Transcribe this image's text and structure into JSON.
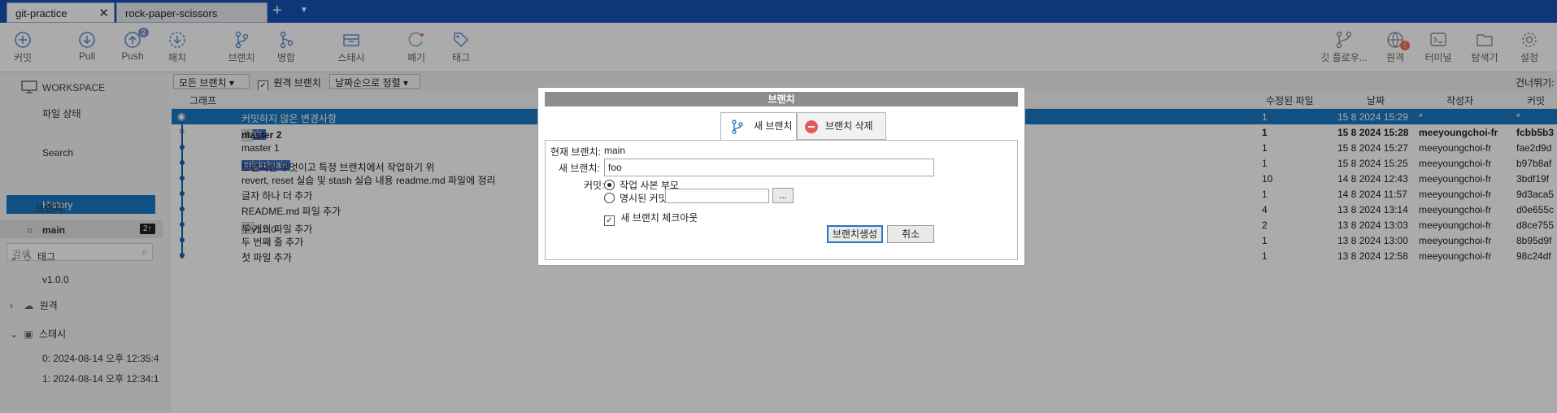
{
  "tabs": [
    {
      "label": "git-practice",
      "active": true
    },
    {
      "label": "rock-paper-scissors",
      "active": false
    }
  ],
  "toolbar": {
    "commit": "커밋",
    "pull": "Pull",
    "push": "Push",
    "push_badge": "2",
    "fetch": "패치",
    "branch": "브랜치",
    "merge": "병합",
    "stash": "스태시",
    "discard": "폐기",
    "tag": "태그",
    "git_flow": "깃 플로우...",
    "remote": "원격",
    "remote_badge": "!",
    "terminal": "터미널",
    "explorer": "탐색기",
    "settings": "설정"
  },
  "sidebar": {
    "workspace": "WORKSPACE",
    "file_status": "파일 상태",
    "history": "History",
    "search": "Search",
    "search_placeholder": "검색",
    "branches_header": "브랜치",
    "branch_main": "main",
    "branch_main_badge": "2↑",
    "tags_header": "태그",
    "tag_v1": "v1.0.0",
    "remotes_header": "원격",
    "stashes_header": "스태시",
    "stash_0": "0: 2024-08-14 오후 12:35:4",
    "stash_1": "1: 2024-08-14 오후 12:34:1"
  },
  "filter": {
    "all_branches": "모든 브랜치 ▾",
    "remote_branches": "원격 브랜치",
    "sort": "날짜순으로 정렬 ▾",
    "skip": "건너뛰기:"
  },
  "columns": {
    "graph": "그래프",
    "modified": "수정된 파일",
    "date": "날짜",
    "author": "작성자",
    "commit": "커밋"
  },
  "commits": [
    {
      "desc": "커밋하지 않은 변경사항",
      "modified": "1",
      "date": "15 8 2024 15:29",
      "author": "*",
      "hash": "*",
      "selected": true
    },
    {
      "desc": "master 2",
      "tag_main": "main",
      "tag_count": "2",
      "modified": "1",
      "date": "15 8 2024 15:28",
      "author": "meeyoungchoi-fr",
      "hash": "fcbb5b3",
      "bold": true
    },
    {
      "desc": "master 1",
      "modified": "1",
      "date": "15 8 2024 15:27",
      "author": "meeyoungchoi-fr",
      "hash": "fae2d9d"
    },
    {
      "desc": "브랜치란 무엇이고 특정 브랜치에서 작업하기 위",
      "tag_origin": "origin/main",
      "modified": "1",
      "date": "15 8 2024 15:25",
      "author": "meeyoungchoi-fr",
      "hash": "b97b8af"
    },
    {
      "desc": "revert, reset 실습 및 stash 실습 내용 readme.md 파일에 정리",
      "modified": "10",
      "date": "14 8 2024 12:43",
      "author": "meeyoungchoi-fr",
      "hash": "3bdf19f"
    },
    {
      "desc": "글자 하나 더 추가",
      "modified": "1",
      "date": "14 8 2024 11:57",
      "author": "meeyoungchoi-fr",
      "hash": "9d3aca5"
    },
    {
      "desc": "README.md 파일 추가",
      "modified": "4",
      "date": "13 8 2024 13:14",
      "author": "meeyoungchoi-fr",
      "hash": "d0e655c"
    },
    {
      "desc": "두 개의 파일 추가",
      "tag_version": "v1.0.0",
      "modified": "2",
      "date": "13 8 2024 13:03",
      "author": "meeyoungchoi-fr",
      "hash": "d8ce755"
    },
    {
      "desc": "두 번째 줄 추가",
      "modified": "1",
      "date": "13 8 2024 13:00",
      "author": "meeyoungchoi-fr",
      "hash": "8b95d9f"
    },
    {
      "desc": "첫 파일 추가",
      "modified": "1",
      "date": "13 8 2024 12:58",
      "author": "meeyoungchoi-fr",
      "hash": "98c24df"
    }
  ],
  "dialog": {
    "title": "브랜치",
    "tab_new": "새 브랜치",
    "tab_delete": "브랜치 삭제",
    "current_branch_label": "현재 브랜치:",
    "current_branch_value": "main",
    "new_branch_label": "새 브랜치:",
    "new_branch_value": "foo",
    "commit_label": "커밋:",
    "radio_working_parent": "작업 사본 부모",
    "radio_specific_commit": "명시된 커밋:",
    "browse": "...",
    "checkout_label": "새 브랜치 체크아웃",
    "create_button": "브랜치생성",
    "cancel_button": "취소"
  },
  "colors": {
    "titlebar": "#1553b5",
    "accent": "#1a78c2",
    "graph": "#1a5fb0"
  }
}
